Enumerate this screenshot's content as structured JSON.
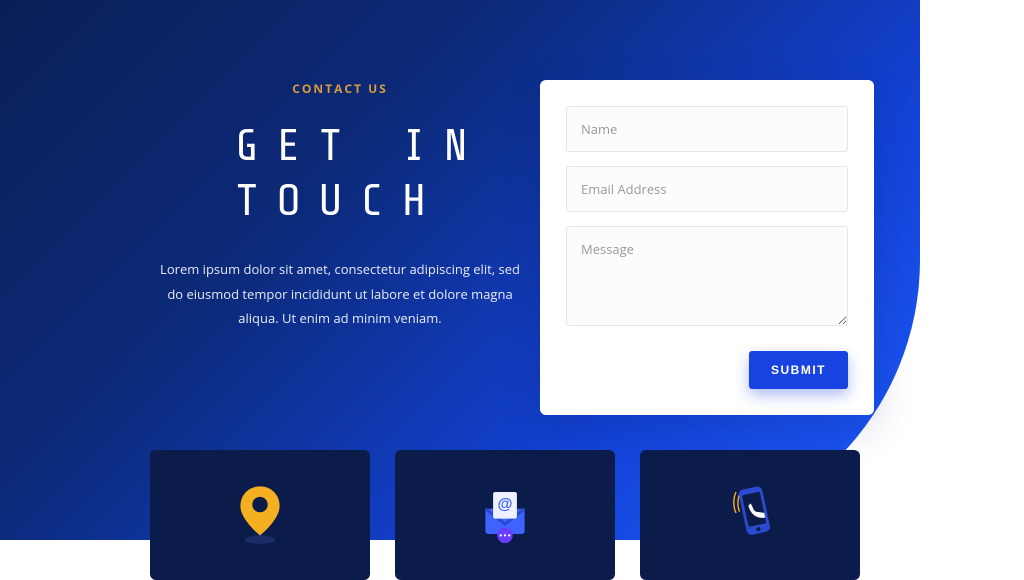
{
  "hero": {
    "eyebrow": "CONTACT US",
    "title": "GET IN\nTOUCH",
    "description": "Lorem ipsum dolor sit amet, consectetur adipiscing elit, sed do eiusmod tempor incididunt ut labore et dolore magna aliqua. Ut enim ad minim veniam."
  },
  "form": {
    "name_placeholder": "Name",
    "email_placeholder": "Email Address",
    "message_placeholder": "Message",
    "submit_label": "SUBMIT"
  },
  "cards": {
    "location": "location",
    "email": "email",
    "phone": "phone"
  }
}
